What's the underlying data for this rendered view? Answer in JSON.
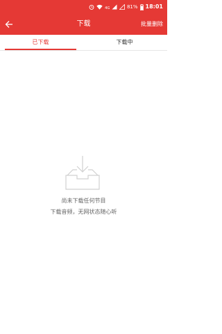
{
  "status_bar": {
    "battery_pct": "81%",
    "time": "18:01"
  },
  "header": {
    "title": "下载",
    "batch_delete": "批量删除"
  },
  "tabs": [
    {
      "label": "已下载",
      "active": true
    },
    {
      "label": "下载中",
      "active": false
    }
  ],
  "empty_state": {
    "line1": "尚未下载任何节目",
    "line2": "下载音频，无网状态随心听"
  },
  "colors": {
    "accent": "#e53935",
    "text_muted": "#666666",
    "icon_gray": "#d0d0d0"
  },
  "icons": {
    "back": "arrow-left-icon",
    "empty": "download-tray-icon"
  }
}
